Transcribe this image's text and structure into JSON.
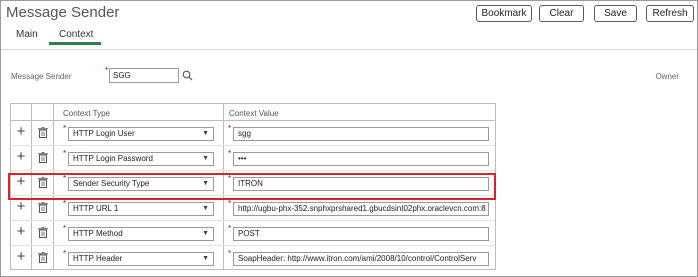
{
  "header": {
    "title": "Message Sender",
    "buttons": {
      "bookmark": "Bookmark",
      "clear": "Clear",
      "save": "Save",
      "refresh": "Refresh"
    }
  },
  "tabs": {
    "main": "Main",
    "context": "Context"
  },
  "form": {
    "sender_label": "Message Sender",
    "sender_value": "SGG",
    "owner_label": "Owner"
  },
  "grid": {
    "columns": {
      "type": "Context Type",
      "value": "Context Value"
    },
    "rows": [
      {
        "type": "HTTP Login User",
        "value": "sgg"
      },
      {
        "type": "HTTP Login Password",
        "value": "•••"
      },
      {
        "type": "Sender Security Type",
        "value": "ITRON"
      },
      {
        "type": "HTTP URL 1",
        "value": "http://ugbu-phx-352.snphxprshared1.gbucdsint02phx.oraclevcn.com:8"
      },
      {
        "type": "HTTP Method",
        "value": "POST"
      },
      {
        "type": "HTTP Header",
        "value": "SoapHeader: http://www.itron.com/ami/2008/10/control/ControlServ"
      }
    ]
  },
  "colors": {
    "accent": "#2e7d4f",
    "highlight": "#d9242e",
    "required": "#cc0000"
  }
}
